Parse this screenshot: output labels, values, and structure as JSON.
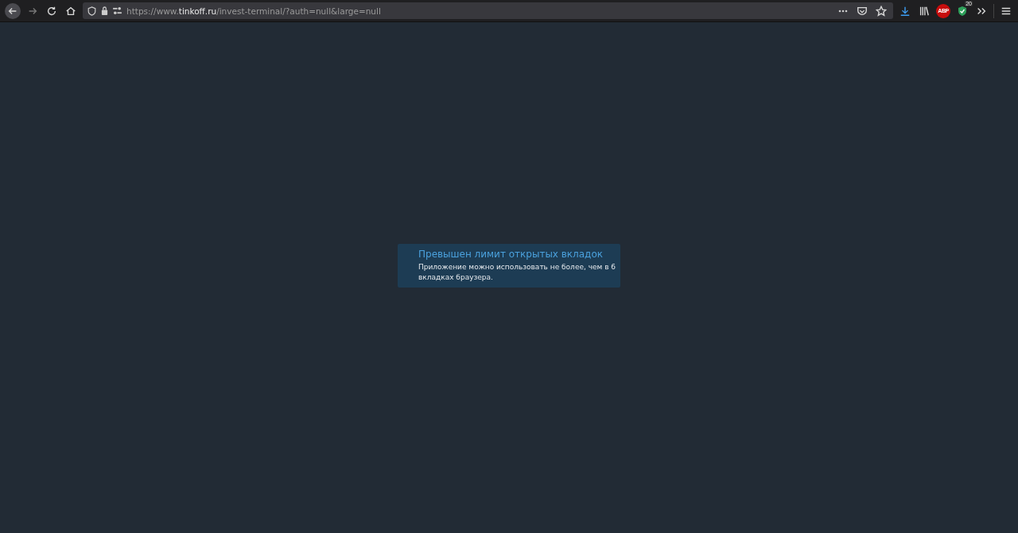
{
  "browser": {
    "url_scheme": "https://www.",
    "url_domain": "tinkoff.ru",
    "url_path": "/invest-terminal/?auth=null&large=null",
    "adblock_label": "ABP",
    "shield_count": "20"
  },
  "notice": {
    "title": "Превышен лимит открытых вкладок",
    "message": "Приложение можно использовать не более, чем в 6 вкладках браузера."
  }
}
